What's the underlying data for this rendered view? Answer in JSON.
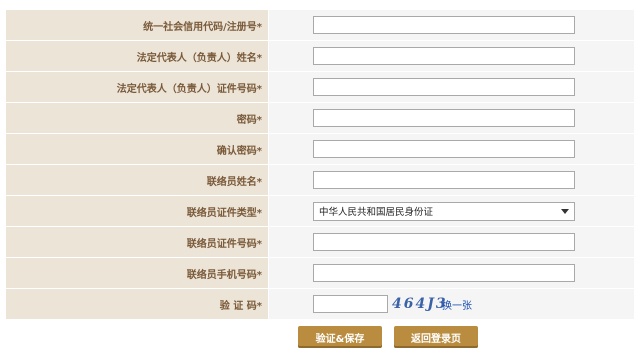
{
  "form": {
    "fields": [
      {
        "label": "统一社会信用代码/注册号*",
        "type": "text",
        "value": ""
      },
      {
        "label": "法定代表人（负责人）姓名*",
        "type": "text",
        "value": ""
      },
      {
        "label": "法定代表人（负责人）证件号码*",
        "type": "text",
        "value": ""
      },
      {
        "label": "密码*",
        "type": "password",
        "value": ""
      },
      {
        "label": "确认密码*",
        "type": "password",
        "value": ""
      },
      {
        "label": "联络员姓名*",
        "type": "text",
        "value": ""
      },
      {
        "label": "联络员证件类型*",
        "type": "select",
        "value": "中华人民共和国居民身份证"
      },
      {
        "label": "联络员证件号码*",
        "type": "text",
        "value": ""
      },
      {
        "label": "联络员手机号码*",
        "type": "text",
        "value": ""
      },
      {
        "label": "验 证 码*",
        "type": "captcha",
        "value": "",
        "captcha_text": "464J3",
        "refresh_label": "换一张"
      }
    ]
  },
  "buttons": {
    "save_label": "验证&保存",
    "back_label": "返回登录页"
  },
  "colors": {
    "label_bg": "#ece4d7",
    "label_text": "#7a5a3a",
    "button_bg": "#b98c3f",
    "link": "#1a4fb0"
  }
}
